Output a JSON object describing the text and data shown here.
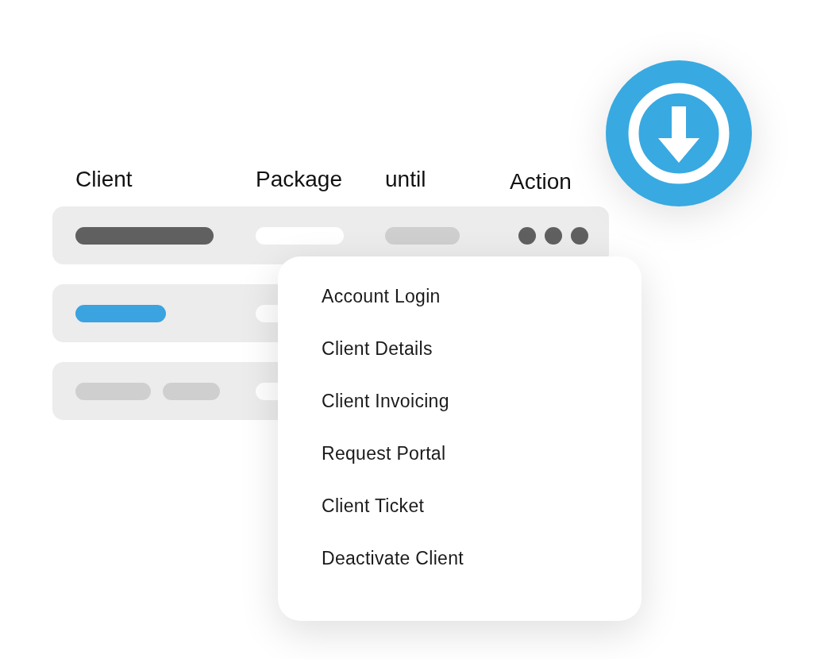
{
  "table": {
    "columns": [
      "Client",
      "Package",
      "until",
      "Action"
    ],
    "rows": [
      {
        "kind": "dark"
      },
      {
        "kind": "highlight"
      },
      {
        "kind": "muted"
      }
    ]
  },
  "menu": {
    "items": [
      "Account Login",
      "Client Details",
      "Client Invoicing",
      "Request Portal",
      "Client Ticket",
      "Deactivate Client"
    ]
  }
}
